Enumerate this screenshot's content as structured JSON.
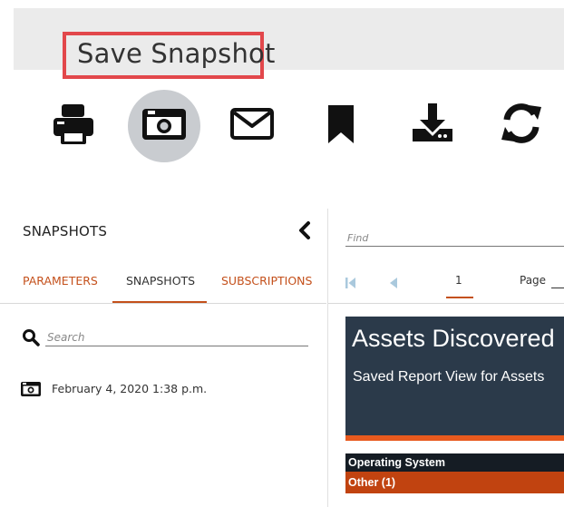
{
  "tooltip": {
    "label": "Save Snapshot"
  },
  "toolbar": {
    "items": [
      {
        "icon": "print-icon"
      },
      {
        "icon": "camera-icon",
        "active": true
      },
      {
        "icon": "envelope-icon"
      },
      {
        "icon": "bookmark-icon"
      },
      {
        "icon": "download-icon"
      },
      {
        "icon": "refresh-icon"
      }
    ]
  },
  "left_panel": {
    "title": "SNAPSHOTS",
    "tabs": [
      {
        "label": "PARAMETERS"
      },
      {
        "label": "SNAPSHOTS",
        "active": true
      },
      {
        "label": "SUBSCRIPTIONS"
      }
    ],
    "search": {
      "placeholder": "Search"
    },
    "snapshots": [
      {
        "label": "February 4, 2020 1:38 p.m."
      }
    ]
  },
  "viewer": {
    "find": {
      "placeholder": "Find"
    },
    "pager": {
      "current_page": "1",
      "page_label": "Page"
    },
    "report": {
      "title": "Assets Discovered",
      "subtitle": "Saved Report View for Assets",
      "group_header": "Operating System",
      "group_row": "Other (1)"
    }
  },
  "colors": {
    "accent": "#c4501b",
    "tooltip_border": "#e2474b",
    "report_bg": "#2b3a4a",
    "report_accent": "#e85a1e",
    "row_highlight": "#c14310"
  }
}
